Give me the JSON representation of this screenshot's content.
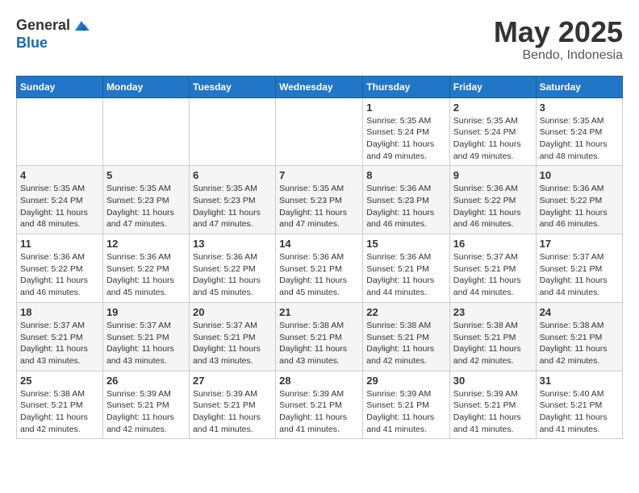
{
  "logo": {
    "general": "General",
    "blue": "Blue"
  },
  "title": {
    "month_year": "May 2025",
    "location": "Bendo, Indonesia"
  },
  "weekdays": [
    "Sunday",
    "Monday",
    "Tuesday",
    "Wednesday",
    "Thursday",
    "Friday",
    "Saturday"
  ],
  "weeks": [
    [
      {
        "day": "",
        "info": ""
      },
      {
        "day": "",
        "info": ""
      },
      {
        "day": "",
        "info": ""
      },
      {
        "day": "",
        "info": ""
      },
      {
        "day": "1",
        "info": "Sunrise: 5:35 AM\nSunset: 5:24 PM\nDaylight: 11 hours and 49 minutes."
      },
      {
        "day": "2",
        "info": "Sunrise: 5:35 AM\nSunset: 5:24 PM\nDaylight: 11 hours and 49 minutes."
      },
      {
        "day": "3",
        "info": "Sunrise: 5:35 AM\nSunset: 5:24 PM\nDaylight: 11 hours and 48 minutes."
      }
    ],
    [
      {
        "day": "4",
        "info": "Sunrise: 5:35 AM\nSunset: 5:24 PM\nDaylight: 11 hours and 48 minutes."
      },
      {
        "day": "5",
        "info": "Sunrise: 5:35 AM\nSunset: 5:23 PM\nDaylight: 11 hours and 47 minutes."
      },
      {
        "day": "6",
        "info": "Sunrise: 5:35 AM\nSunset: 5:23 PM\nDaylight: 11 hours and 47 minutes."
      },
      {
        "day": "7",
        "info": "Sunrise: 5:35 AM\nSunset: 5:23 PM\nDaylight: 11 hours and 47 minutes."
      },
      {
        "day": "8",
        "info": "Sunrise: 5:36 AM\nSunset: 5:23 PM\nDaylight: 11 hours and 46 minutes."
      },
      {
        "day": "9",
        "info": "Sunrise: 5:36 AM\nSunset: 5:22 PM\nDaylight: 11 hours and 46 minutes."
      },
      {
        "day": "10",
        "info": "Sunrise: 5:36 AM\nSunset: 5:22 PM\nDaylight: 11 hours and 46 minutes."
      }
    ],
    [
      {
        "day": "11",
        "info": "Sunrise: 5:36 AM\nSunset: 5:22 PM\nDaylight: 11 hours and 46 minutes."
      },
      {
        "day": "12",
        "info": "Sunrise: 5:36 AM\nSunset: 5:22 PM\nDaylight: 11 hours and 45 minutes."
      },
      {
        "day": "13",
        "info": "Sunrise: 5:36 AM\nSunset: 5:22 PM\nDaylight: 11 hours and 45 minutes."
      },
      {
        "day": "14",
        "info": "Sunrise: 5:36 AM\nSunset: 5:21 PM\nDaylight: 11 hours and 45 minutes."
      },
      {
        "day": "15",
        "info": "Sunrise: 5:36 AM\nSunset: 5:21 PM\nDaylight: 11 hours and 44 minutes."
      },
      {
        "day": "16",
        "info": "Sunrise: 5:37 AM\nSunset: 5:21 PM\nDaylight: 11 hours and 44 minutes."
      },
      {
        "day": "17",
        "info": "Sunrise: 5:37 AM\nSunset: 5:21 PM\nDaylight: 11 hours and 44 minutes."
      }
    ],
    [
      {
        "day": "18",
        "info": "Sunrise: 5:37 AM\nSunset: 5:21 PM\nDaylight: 11 hours and 43 minutes."
      },
      {
        "day": "19",
        "info": "Sunrise: 5:37 AM\nSunset: 5:21 PM\nDaylight: 11 hours and 43 minutes."
      },
      {
        "day": "20",
        "info": "Sunrise: 5:37 AM\nSunset: 5:21 PM\nDaylight: 11 hours and 43 minutes."
      },
      {
        "day": "21",
        "info": "Sunrise: 5:38 AM\nSunset: 5:21 PM\nDaylight: 11 hours and 43 minutes."
      },
      {
        "day": "22",
        "info": "Sunrise: 5:38 AM\nSunset: 5:21 PM\nDaylight: 11 hours and 42 minutes."
      },
      {
        "day": "23",
        "info": "Sunrise: 5:38 AM\nSunset: 5:21 PM\nDaylight: 11 hours and 42 minutes."
      },
      {
        "day": "24",
        "info": "Sunrise: 5:38 AM\nSunset: 5:21 PM\nDaylight: 11 hours and 42 minutes."
      }
    ],
    [
      {
        "day": "25",
        "info": "Sunrise: 5:38 AM\nSunset: 5:21 PM\nDaylight: 11 hours and 42 minutes."
      },
      {
        "day": "26",
        "info": "Sunrise: 5:39 AM\nSunset: 5:21 PM\nDaylight: 11 hours and 42 minutes."
      },
      {
        "day": "27",
        "info": "Sunrise: 5:39 AM\nSunset: 5:21 PM\nDaylight: 11 hours and 41 minutes."
      },
      {
        "day": "28",
        "info": "Sunrise: 5:39 AM\nSunset: 5:21 PM\nDaylight: 11 hours and 41 minutes."
      },
      {
        "day": "29",
        "info": "Sunrise: 5:39 AM\nSunset: 5:21 PM\nDaylight: 11 hours and 41 minutes."
      },
      {
        "day": "30",
        "info": "Sunrise: 5:39 AM\nSunset: 5:21 PM\nDaylight: 11 hours and 41 minutes."
      },
      {
        "day": "31",
        "info": "Sunrise: 5:40 AM\nSunset: 5:21 PM\nDaylight: 11 hours and 41 minutes."
      }
    ]
  ]
}
